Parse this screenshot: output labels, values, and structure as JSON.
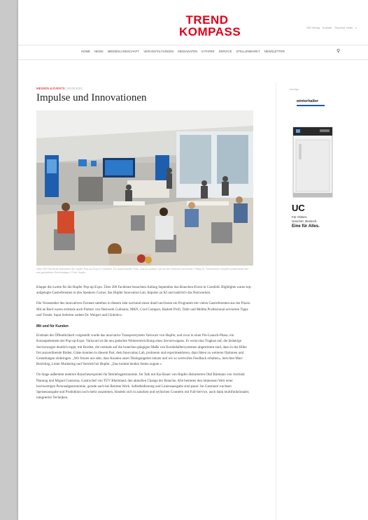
{
  "header": {
    "logo_line1": "TREND",
    "logo_line2": "KOMPASS",
    "top_links": [
      "SW Verlag",
      "Kontakt",
      "Superior Hotel"
    ],
    "login_label": "•"
  },
  "nav": {
    "items": [
      "HOME",
      "NEWS",
      "MEDIENLANDSCHAFT",
      "VERANSTALTUNGEN",
      "MEDIADATEN",
      "E-PAPER",
      "SERVICE",
      "STELLENMARKT",
      "NEWSLETTER"
    ],
    "search_icon": "search-icon"
  },
  "article": {
    "category": "MESSEN & EVENTS",
    "date": "| 28.09.2022",
    "title": "Impulse und Innovationen",
    "caption": "Über 200 Fachleute besuchten die Hupfer Pop-up-Expo in Coesfeld. Ein ausverkaufter Park: Das Innovation Lab mit der Hochzeit-Serviceart: Philipp M. Schumacher (Hupfer) präsentierte den neu gestalteten Servierwagen / Foto: Hupfer",
    "paragraphs": [
      "Klappe die zweite für die Hupfer Pop-up-Expo. Über 200 Fachleute besuchten Anfang September das Branchen-Event in Coesfeld. Highlights waren top-aufgelegte Gastreferenten in den Speakers Corner, das Hupfer Innovation Lab, Impulse zu KI und natürlich das Netzwerken.",
      "Die Veranstalter des innovativen Formats sattelten in diesem Jahr nochmal einen drauf und boten ein Programm mit vielen Gastreferenten aus der Praxis. Mit an Bord waren erstmals auch Partner von Netzwerk Culinaria, MKN, Cool Compact, Baskett Profi, Tobit und Melitta Professional servierten Tipps und Trends. Input lieferten zudem Dr. Weigert und Globotics."
    ],
    "subheading": "Mit und für Kunden",
    "paragraphs2": [
      "Erstmals der Öffentlichkeit vorgestellt wurde das innovative Transportsystem Variocart von Hupfer, und zwar in einer Pre-Launch-Phase, ein Konzeptelement der Pop-up-Expo. Variocart ist die neu gedachte Weiterentwicklung eines Servierwagens. Er weist eine Traglast auf, die bisherige Servierwagen deutlich toppt, mit Borden, die erstmals auf die branchen-gängigen Maße von Eurobehältersystemen abgestimmt sind, dazu in der Höhe frei anzuordnende Böden. Gäste konnten in diesem Part, dem Innovation Lab, probieren und experimentieren, dazu Ideen zu weiteren Optionen und Gestaltungen einbringen. „Wir freuen uns sehr, dass Kunden unser Dialogangebot nutzen und wir so wertvolles Feedback erhalten«, berichtet Marc Reichling, Leiter Marketing und Vertrieb bei Hupfer. „Das kommt beiden Seiten zugute.«",
      "On Stage außerdem mehrere Branchenexperten für Betriebsgastronomie. Im Talk mit Kai Bauer von Hupfer diskutierten Olaf Bärmann von vtechnik Planung und Miguel Contreras, Gastrochef von TÜV Rheinland, den aktuellen Change der Branche. Alle betonten den immensen Wert einer hochwertigen Personalgastronomie, gerade auch bei Remote Work. Selbstbedienung und Liniensausgabe sind passé. Im Gastraum wachsen Speisenausgabe und Produktion noch mehr zusammen, bündeln sich in autarken und stylischen Countern mit Full-Service, auch dank multifunktionaler, integrierter Techniken."
    ]
  },
  "ad": {
    "label": "Anzeige",
    "brand": "winterhalter",
    "model": "UC",
    "line1": "Für Gläser,",
    "line2": "Geschirr, Besteck.",
    "line3": "Eine für Alles."
  },
  "colors": {
    "brand_red": "#e2001a",
    "ad_blue": "#1a5aa8"
  }
}
